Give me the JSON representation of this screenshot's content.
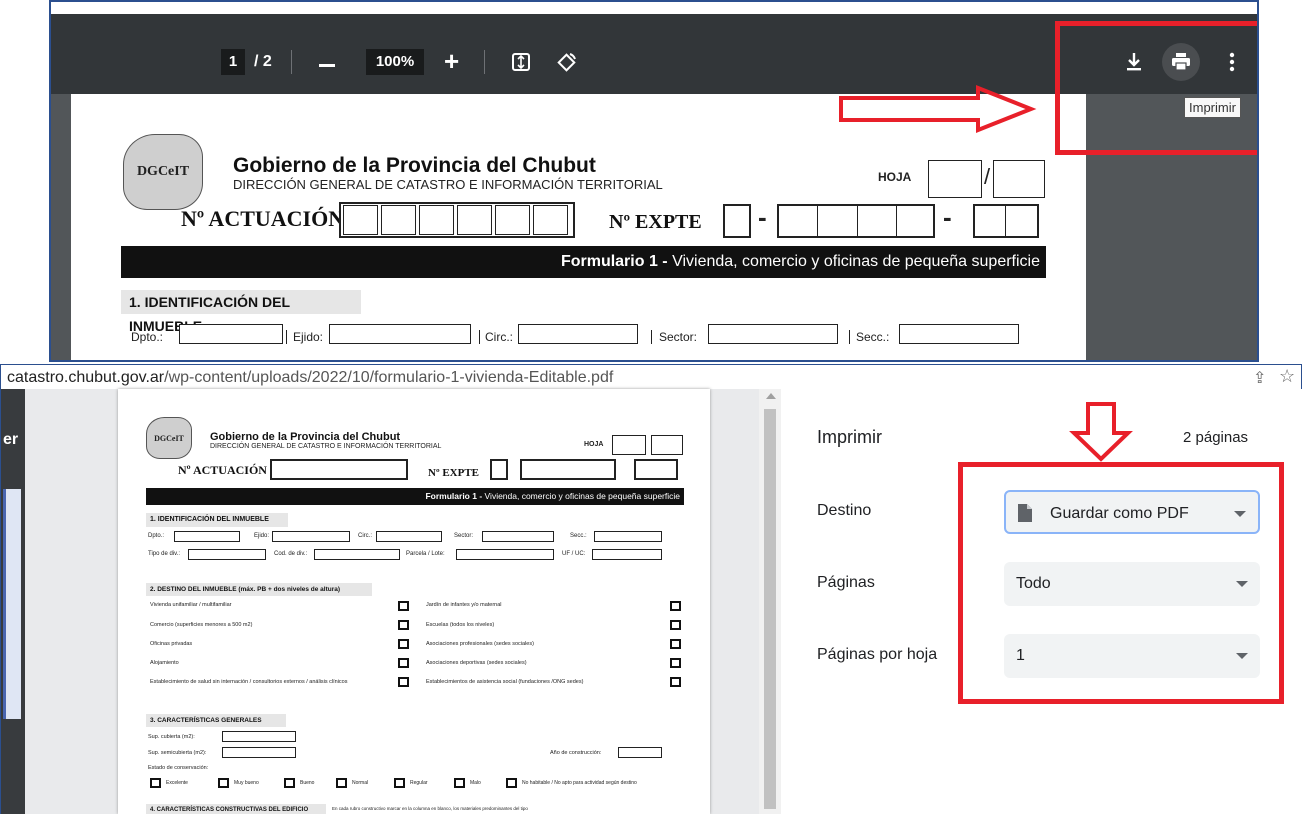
{
  "viewer": {
    "page_current": "1",
    "page_total": "/ 2",
    "zoom": "100%",
    "tooltip": "Imprimir",
    "icons": [
      "minus-icon",
      "plus-icon",
      "fit-page-icon",
      "rotate-icon",
      "download-icon",
      "print-icon",
      "more-vert-icon"
    ]
  },
  "document": {
    "logo_text": "DGCeIT",
    "gov_title": "Gobierno de la Provincia del Chubut",
    "direction": "DIRECCIÓN GENERAL DE CATASTRO E INFORMACIÓN TERRITORIAL",
    "hoja_label": "HOJA",
    "actuacion_label": "Nº ACTUACIÓN",
    "expte_label": "Nº EXPTE",
    "form_title_bold": "Formulario 1 -",
    "form_title_rest": " Vivienda, comercio y oficinas de pequeña superficie",
    "sec1_title": "1. IDENTIFICACIÓN DEL INMUEBLE",
    "f_dpto": "Dpto.:",
    "f_ejido": "Ejido:",
    "f_circ": "Circ.:",
    "f_sector": "Sector:",
    "f_secc": "Secc.:",
    "f_tipo": "Tipo de div.:",
    "f_cod": "Cod. de div.:",
    "f_parcela": "Parcela / Lote:",
    "f_uf": "UF / UC:",
    "sec2_title": "2. DESTINO DEL INMUEBLE  (máx. PB + dos niveles de altura)",
    "dest_left": [
      "Vivienda unifamiliar / multifamiliar",
      "Comercio (superficies menores a 500 m2)",
      "Oficinas privadas",
      "Alojamiento",
      "Establecimiento de salud sin internación / consultorios externos / análisis clínicos"
    ],
    "dest_right": [
      "Jardín de infantes y/o maternal",
      "Escuelas (todos los niveles)",
      "Asociaciones profesionales (sedes sociales)",
      "Asociaciones deportivas (sedes sociales)",
      "Establecimientos de asistencia social (fundaciones /ONG sedes)"
    ],
    "sec3_title": "3. CARACTERÍSTICAS GENERALES",
    "sup_cub": "Sup. cubierta (m2):",
    "sup_semi": "Sup. semicubierta (m2):",
    "anio": "Año de construcción:",
    "estado": "Estado de conservación:",
    "estados": [
      "Excelente",
      "Muy bueno",
      "Bueno",
      "Normal",
      "Regular",
      "Malo",
      "No habitable / No apto para actividad según destino"
    ],
    "sec4_title": "4. CARACTERÍSTICAS CONSTRUCTIVAS DEL EDIFICIO",
    "sec4_note": "En cada rubro constructivo marcar en la columna en blanco, los materiales predominantes del tipo"
  },
  "browser": {
    "url_host": "catastro.chubut.gov.ar",
    "url_path": "/wp-content/uploads/2022/10/formulario-1-vivienda-Editable.pdf",
    "side_text": "er"
  },
  "print_dialog": {
    "title": "Imprimir",
    "count": "2 páginas",
    "destino_label": "Destino",
    "destino_value": "Guardar como PDF",
    "paginas_label": "Páginas",
    "paginas_value": "Todo",
    "pph_label": "Páginas por hoja",
    "pph_value": "1"
  },
  "colors": {
    "annotation_red": "#e8202a",
    "toolbar": "#323639",
    "frame_blue": "#2b4f8f"
  }
}
